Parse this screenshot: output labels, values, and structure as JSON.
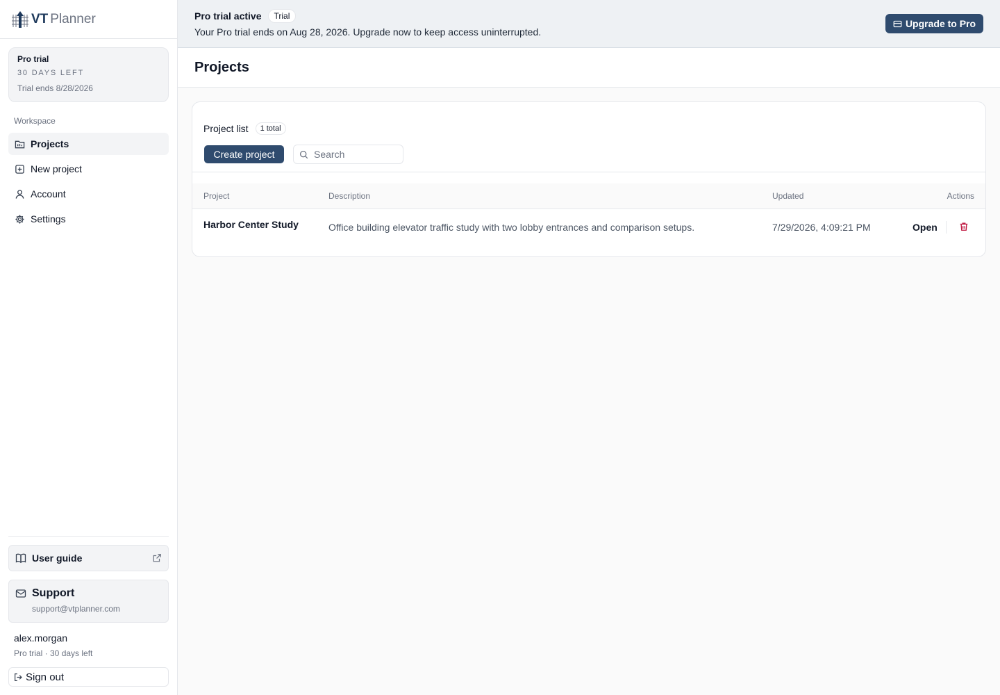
{
  "brand": {
    "name_bold": "VT",
    "name_light": "Planner"
  },
  "trial_card": {
    "title": "Pro trial",
    "days_left": "30 DAYS LEFT",
    "ends": "Trial ends 8/28/2026"
  },
  "sidebar": {
    "section_label": "Workspace",
    "items": [
      {
        "label": "Projects",
        "icon": "projects-icon",
        "active": true
      },
      {
        "label": "New project",
        "icon": "plus-square-icon"
      },
      {
        "label": "Account",
        "icon": "user-icon"
      },
      {
        "label": "Settings",
        "icon": "gear-icon"
      }
    ],
    "user_guide": "User guide",
    "support": {
      "title": "Support",
      "email": "support@vtplanner.com"
    },
    "user": {
      "name": "alex.morgan",
      "plan": "Pro trial · 30 days left"
    },
    "sign_out": "Sign out"
  },
  "banner": {
    "title": "Pro trial active",
    "badge": "Trial",
    "message": "Your Pro trial ends on Aug 28, 2026. Upgrade now to keep access uninterrupted.",
    "upgrade_label": "Upgrade to Pro"
  },
  "page": {
    "title": "Projects"
  },
  "project_list": {
    "title": "Project list",
    "count": "1 total",
    "create_label": "Create project",
    "search_placeholder": "Search",
    "columns": {
      "project": "Project",
      "description": "Description",
      "updated": "Updated",
      "actions": "Actions"
    },
    "rows": [
      {
        "project": "Harbor Center Study",
        "description": "Office building elevator traffic study with two lobby entrances and comparison setups.",
        "updated": "7/29/2026, 4:09:21 PM",
        "open_label": "Open"
      }
    ]
  },
  "colors": {
    "accent": "#2f4b6e",
    "danger": "#be123c",
    "banner_bg": "#eef1f4"
  }
}
